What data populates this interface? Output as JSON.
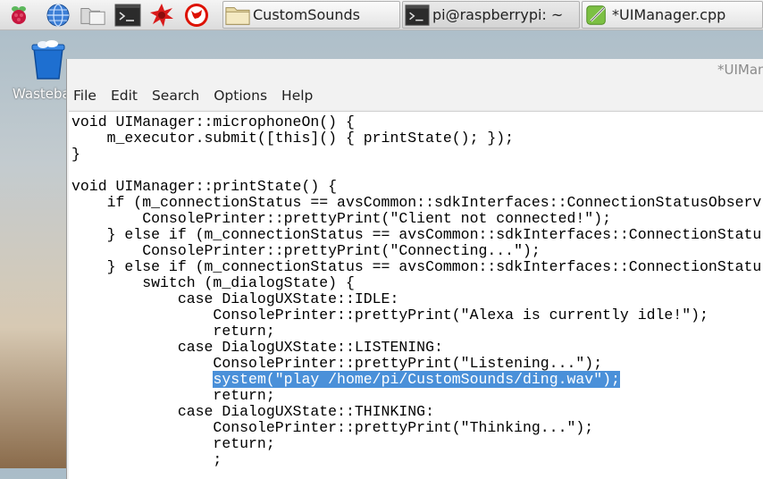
{
  "taskbar": {
    "launchers": [
      {
        "name": "raspberry-menu-icon"
      },
      {
        "name": "web-browser-icon"
      },
      {
        "name": "file-manager-icon"
      },
      {
        "name": "terminal-icon"
      },
      {
        "name": "math-icon"
      },
      {
        "name": "wolfram-icon"
      }
    ],
    "tasks": [
      {
        "name": "task-customsounds",
        "icon": "folder-icon",
        "label": "CustomSounds"
      },
      {
        "name": "task-terminal",
        "icon": "terminal-icon",
        "label": "pi@raspberrypi: ~"
      },
      {
        "name": "task-uimanager",
        "icon": "text-editor-icon",
        "label": "*UIManager.cpp"
      }
    ]
  },
  "desktop": {
    "wastebasket_label": "Wasteba"
  },
  "editor": {
    "title": "*UIMan",
    "menu": [
      "File",
      "Edit",
      "Search",
      "Options",
      "Help"
    ],
    "code_lines": [
      {
        "text": "void UIManager::microphoneOn() {"
      },
      {
        "text": "    m_executor.submit([this]() { printState(); });"
      },
      {
        "text": "}"
      },
      {
        "text": ""
      },
      {
        "text": "void UIManager::printState() {"
      },
      {
        "text": "    if (m_connectionStatus == avsCommon::sdkInterfaces::ConnectionStatusObserv"
      },
      {
        "text": "        ConsolePrinter::prettyPrint(\"Client not connected!\");"
      },
      {
        "text": "    } else if (m_connectionStatus == avsCommon::sdkInterfaces::ConnectionStatu"
      },
      {
        "text": "        ConsolePrinter::prettyPrint(\"Connecting...\");"
      },
      {
        "text": "    } else if (m_connectionStatus == avsCommon::sdkInterfaces::ConnectionStatu"
      },
      {
        "text": "        switch (m_dialogState) {"
      },
      {
        "text": "            case DialogUXState::IDLE:"
      },
      {
        "text": "                ConsolePrinter::prettyPrint(\"Alexa is currently idle!\");"
      },
      {
        "text": "                return;"
      },
      {
        "text": "            case DialogUXState::LISTENING:"
      },
      {
        "text": "                ConsolePrinter::prettyPrint(\"Listening...\");"
      },
      {
        "indent": "                ",
        "text": "system(\"play /home/pi/CustomSounds/ding.wav\");",
        "selected": true
      },
      {
        "text": "                return;"
      },
      {
        "text": "            case DialogUXState::THINKING:"
      },
      {
        "text": "                ConsolePrinter::prettyPrint(\"Thinking...\");"
      },
      {
        "text": "                return;"
      },
      {
        "text": "                ;"
      }
    ]
  },
  "colors": {
    "selection": "#4a90d9",
    "taskbar": "#e6e6e6"
  }
}
